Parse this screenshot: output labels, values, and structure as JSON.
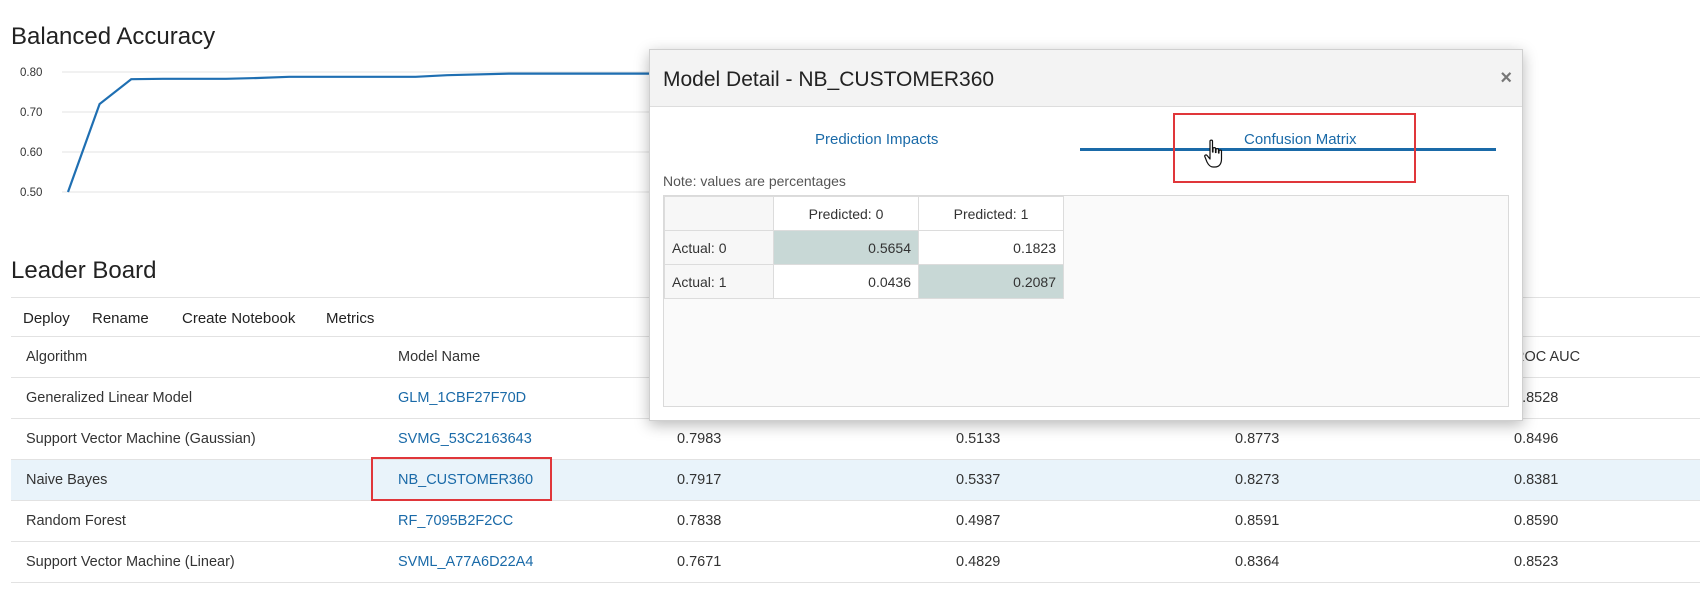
{
  "balanced_accuracy": {
    "title": "Balanced Accuracy",
    "y_ticks": [
      "0.80",
      "0.70",
      "0.60",
      "0.50"
    ]
  },
  "chart_data": {
    "type": "line",
    "title": "Balanced Accuracy",
    "ylim": [
      0.5,
      0.8
    ],
    "grid": true,
    "x": [
      0,
      5,
      10,
      15,
      20,
      25,
      30,
      35,
      40,
      45,
      50,
      55,
      60,
      70,
      90,
      100
    ],
    "series": [
      {
        "values": [
          0.5,
          0.72,
          0.782,
          0.783,
          0.783,
          0.783,
          0.785,
          0.788,
          0.788,
          0.788,
          0.788,
          0.788,
          0.792,
          0.796,
          0.796,
          0.796
        ]
      }
    ],
    "color": "#1f6fb2"
  },
  "leader_board": {
    "title": "Leader Board",
    "toolbar": [
      "Deploy",
      "Rename",
      "Create Notebook",
      "Metrics"
    ],
    "columns": [
      "Algorithm",
      "Model Name",
      "",
      "",
      "",
      "ROC AUC"
    ],
    "rows": [
      [
        "Generalized Linear Model",
        "GLM_1CBF27F70D",
        "",
        "",
        "",
        "0.8528"
      ],
      [
        "Support Vector Machine (Gaussian)",
        "SVMG_53C2163643",
        "0.7983",
        "0.5133",
        "0.8773",
        "0.8496"
      ],
      [
        "Naive Bayes",
        "NB_CUSTOMER360",
        "0.7917",
        "0.5337",
        "0.8273",
        "0.8381"
      ],
      [
        "Random Forest",
        "RF_7095B2F2CC",
        "0.7838",
        "0.4987",
        "0.8591",
        "0.8590"
      ],
      [
        "Support Vector Machine (Linear)",
        "SVML_A77A6D22A4",
        "0.7671",
        "0.4829",
        "0.8364",
        "0.8523"
      ]
    ],
    "selected_row": 2
  },
  "modal": {
    "title": "Model Detail - NB_CUSTOMER360",
    "close": "×",
    "tabs": [
      "Prediction Impacts",
      "Confusion Matrix"
    ],
    "active_tab": "Confusion Matrix",
    "note": "Note: values are percentages",
    "matrix": {
      "col_headers": [
        "Predicted: 0",
        "Predicted: 1"
      ],
      "rows": [
        {
          "label": "Actual: 0",
          "values": [
            "0.5654",
            "0.1823"
          ]
        },
        {
          "label": "Actual: 1",
          "values": [
            "0.0436",
            "0.2087"
          ]
        }
      ]
    }
  },
  "colors": {
    "accent": "#1a6aa8",
    "line": "#1f6fb2",
    "highlight": "#e0363a",
    "selected_row": "#e9f3fa",
    "diagonal_cell": "#c8d8d6"
  }
}
